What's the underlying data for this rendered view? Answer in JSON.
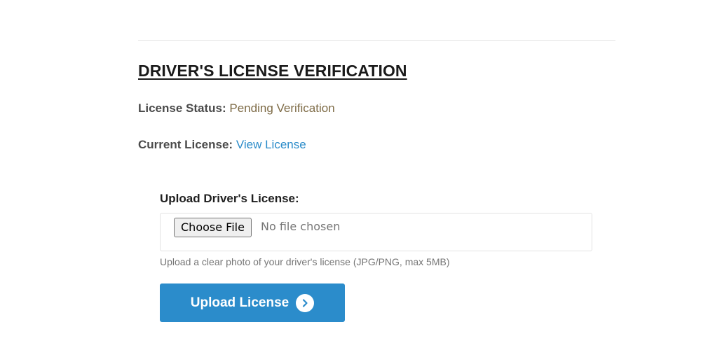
{
  "section": {
    "title": "DRIVER'S LICENSE VERIFICATION"
  },
  "status": {
    "label": "License Status:",
    "value": "Pending Verification",
    "value_color": "#7d6a45"
  },
  "current": {
    "label": "Current License:",
    "link_text": "View License",
    "link_color": "#2a8bc9"
  },
  "upload": {
    "label": "Upload Driver's License:",
    "choose_button": "Choose File",
    "no_file_text": "No file chosen",
    "hint": "Upload a clear photo of your driver's license (JPG/PNG, max 5MB)",
    "submit_label": "Upload License",
    "submit_icon": "chevron-right-circle-icon",
    "button_color": "#2b8ccb"
  }
}
